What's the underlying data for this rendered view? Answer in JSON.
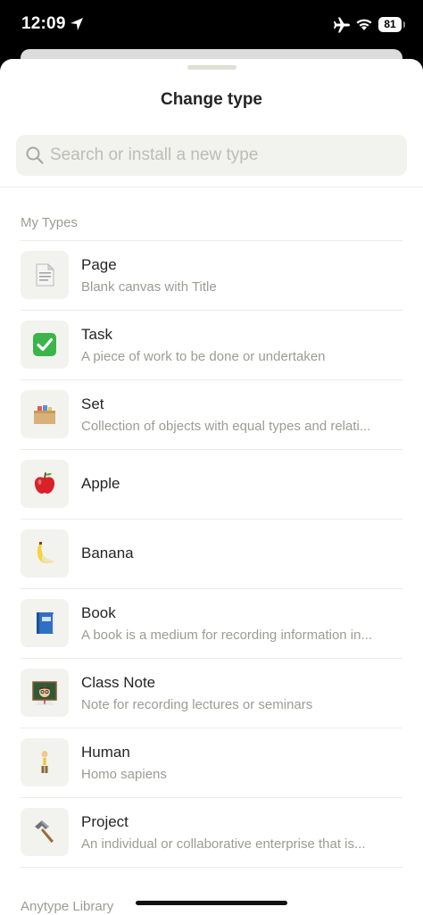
{
  "status_bar": {
    "time": "12:09",
    "battery": "81"
  },
  "sheet": {
    "title": "Change type",
    "search_placeholder": "Search or install a new type"
  },
  "sections": {
    "my_types": "My Types",
    "library": "Anytype Library"
  },
  "types": [
    {
      "name": "Page",
      "description": "Blank canvas with Title",
      "icon": "page-icon"
    },
    {
      "name": "Task",
      "description": "A piece of work to be done or undertaken",
      "icon": "checkmark-icon"
    },
    {
      "name": "Set",
      "description": "Collection of objects with equal types and relati...",
      "icon": "card-box-icon"
    },
    {
      "name": "Apple",
      "description": "",
      "icon": "apple-icon"
    },
    {
      "name": "Banana",
      "description": "",
      "icon": "banana-icon"
    },
    {
      "name": "Book",
      "description": "A book is a medium for recording information in...",
      "icon": "book-icon"
    },
    {
      "name": "Class Note",
      "description": "Note for recording lectures or seminars",
      "icon": "teacher-icon"
    },
    {
      "name": "Human",
      "description": "Homo sapiens",
      "icon": "person-icon"
    },
    {
      "name": "Project",
      "description": "An individual or collaborative enterprise that is...",
      "icon": "hammer-icon"
    }
  ],
  "colors": {
    "sheet_background": "#ffffff",
    "search_background": "#f2f2ee",
    "primary_text": "#252525",
    "secondary_text": "#9c9c95",
    "task_check_green": "#3bb54a"
  }
}
